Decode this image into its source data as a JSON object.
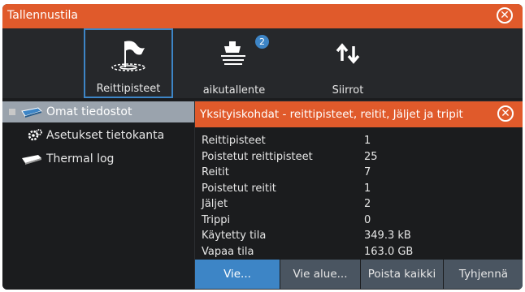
{
  "window": {
    "title": "Tallennustila"
  },
  "toolbar": {
    "items": [
      {
        "label": "Reittipisteet",
        "icon": "waypoint-flag-icon",
        "selected": true
      },
      {
        "label": "aikutallente",
        "icon": "vessel-track-icon",
        "badge": "2"
      },
      {
        "label": "Siirrot",
        "icon": "transfer-arrows-icon"
      }
    ]
  },
  "tree": {
    "items": [
      {
        "label": "Omat tiedostot",
        "icon": "storage-disk-icon",
        "selected": true
      },
      {
        "label": "Asetukset tietokanta",
        "icon": "settings-database-icon"
      },
      {
        "label": "Thermal log",
        "icon": "storage-disk-icon"
      }
    ]
  },
  "dialog": {
    "title": "Yksityiskohdat - reittipisteet, reitit, Jäljet ja tripit",
    "rows": [
      {
        "key": "Reittipisteet",
        "value": "1"
      },
      {
        "key": "Poistetut reittipisteet",
        "value": "25"
      },
      {
        "key": "Reitit",
        "value": "7"
      },
      {
        "key": "Poistetut reitit",
        "value": "1"
      },
      {
        "key": "Jäljet",
        "value": "2"
      },
      {
        "key": "Trippi",
        "value": "0"
      },
      {
        "key": "Käytetty tila",
        "value": "349.3 kB"
      },
      {
        "key": "Vapaa tila",
        "value": "163.0 GB"
      }
    ],
    "buttons": [
      {
        "label": "Vie..."
      },
      {
        "label": "Vie alue..."
      },
      {
        "label": "Poista kaikki"
      },
      {
        "label": "Tyhjennä"
      }
    ]
  },
  "colors": {
    "accent": "#e05a2b",
    "selection": "#3d85c6",
    "background": "#1b1c1e"
  }
}
